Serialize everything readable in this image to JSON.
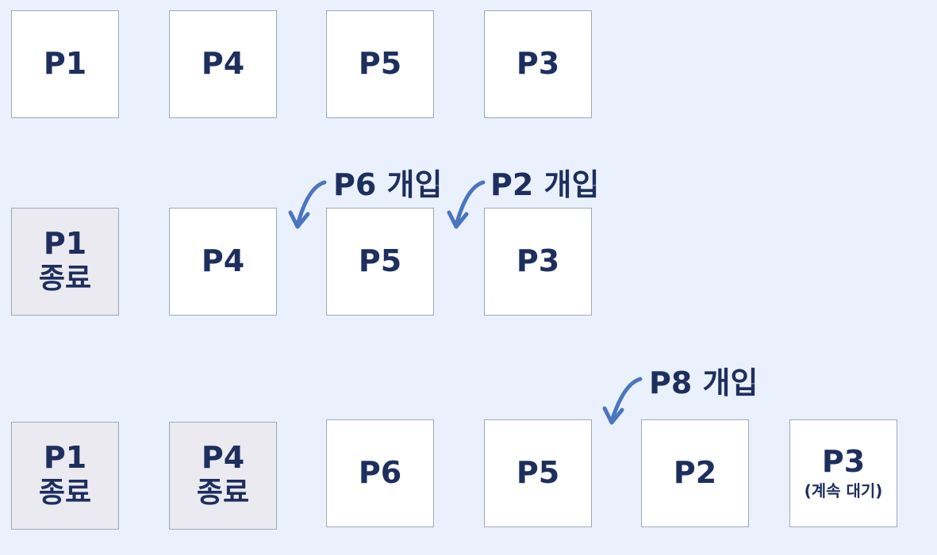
{
  "row1": [
    "P1",
    "P4",
    "P5",
    "P3"
  ],
  "row2": {
    "p1": {
      "name": "P1",
      "status": "종료"
    },
    "p4": "P4",
    "p5": "P5",
    "p3": "P3"
  },
  "row3": {
    "p1": {
      "name": "P1",
      "status": "종료"
    },
    "p4": {
      "name": "P4",
      "status": "종료"
    },
    "p6": "P6",
    "p5": "P5",
    "p2": "P2",
    "p3": {
      "name": "P3",
      "note": "(계속 대기)"
    }
  },
  "annotations": {
    "p6_enter": "P6 개입",
    "p2_enter": "P2 개입",
    "p8_enter": "P8 개입"
  },
  "colors": {
    "background": "#ebf1fc",
    "box_active": "#ffffff",
    "box_done": "#ebeaf0",
    "text": "#1d2f5e",
    "arrow": "#4a76c0"
  }
}
